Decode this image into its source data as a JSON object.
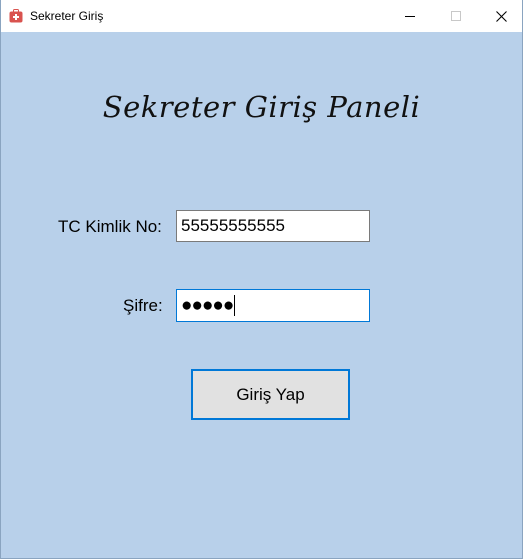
{
  "window": {
    "title": "Sekreter Giriş",
    "app_icon": "medical-kit-icon",
    "controls": [
      "minimize-icon",
      "maximize-icon",
      "close-icon"
    ]
  },
  "form": {
    "heading": "Sekreter Giriş Paneli",
    "tc_label": "TC Kimlik No:",
    "tc_value": "55555555555",
    "password_label": "Şifre:",
    "password_masked": "●●●●●",
    "login_button": "Giriş Yap"
  },
  "colors": {
    "background": "#b8d0ea",
    "focus_border": "#0078d7",
    "button_bg": "#e1e1e1",
    "app_icon": "#d9534f"
  }
}
